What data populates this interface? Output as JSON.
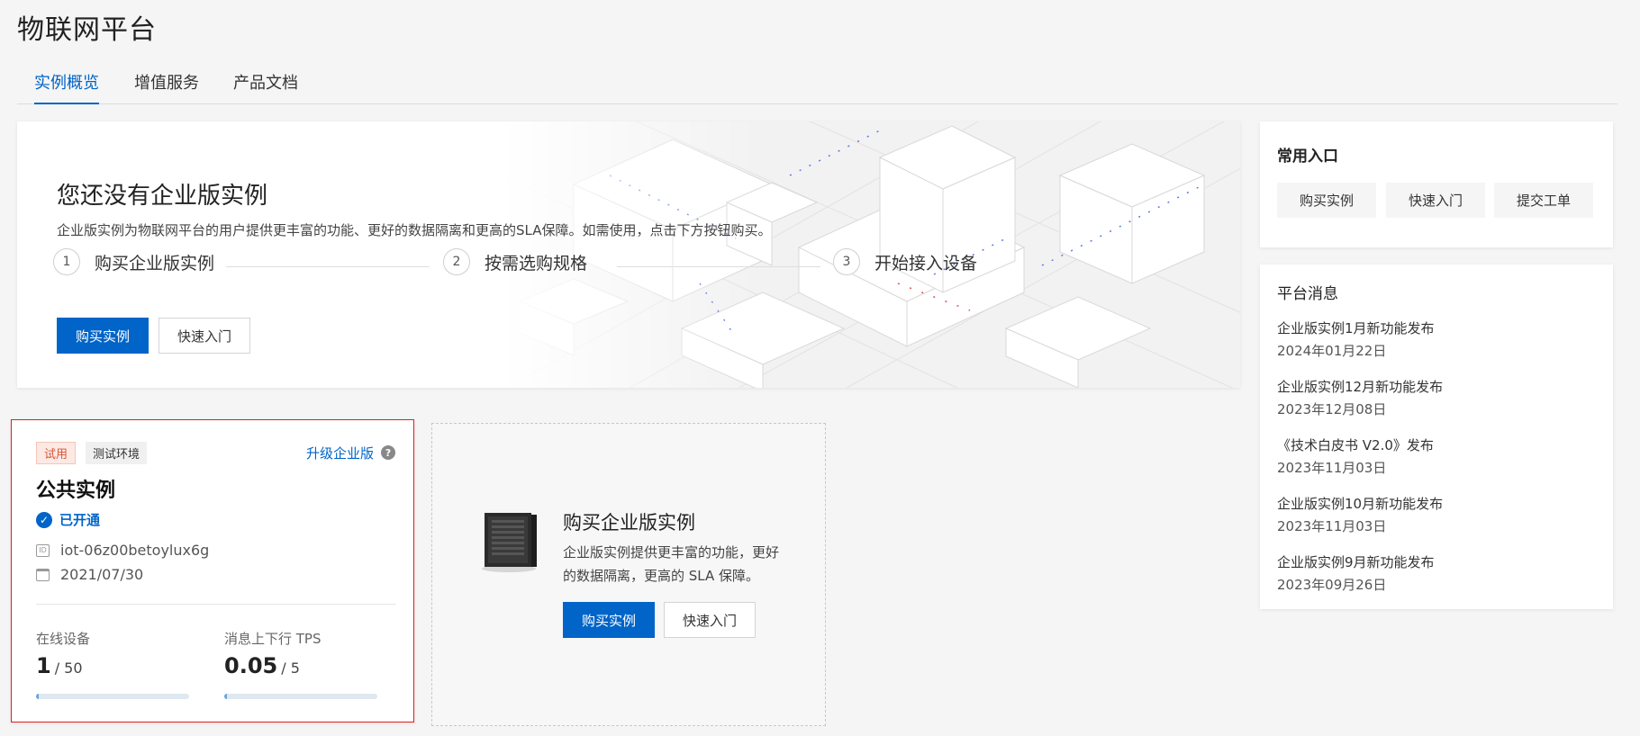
{
  "page": {
    "title": "物联网平台"
  },
  "tabs": [
    {
      "label": "实例概览",
      "active": true
    },
    {
      "label": "增值服务",
      "active": false
    },
    {
      "label": "产品文档",
      "active": false
    }
  ],
  "banner": {
    "title": "您还没有企业版实例",
    "description": "企业版实例为物联网平台的用户提供更丰富的功能、更好的数据隔离和更高的SLA保障。如需使用，点击下方按钮购买。",
    "steps": [
      {
        "num": "1",
        "label": "购买企业版实例"
      },
      {
        "num": "2",
        "label": "按需选购规格"
      },
      {
        "num": "3",
        "label": "开始接入设备"
      }
    ],
    "buy_button": "购买实例",
    "quickstart_button": "快速入门"
  },
  "common_entry": {
    "title": "常用入口",
    "buttons": [
      "购买实例",
      "快速入门",
      "提交工单"
    ]
  },
  "platform_news": {
    "title": "平台消息",
    "items": [
      {
        "title": "企业版实例1月新功能发布",
        "date": "2024年01月22日"
      },
      {
        "title": "企业版实例12月新功能发布",
        "date": "2023年12月08日"
      },
      {
        "title": "《技术白皮书 V2.0》发布",
        "date": "2023年11月03日"
      },
      {
        "title": "企业版实例10月新功能发布",
        "date": "2023年11月03日"
      },
      {
        "title": "企业版实例9月新功能发布",
        "date": "2023年09月26日"
      }
    ]
  },
  "instance": {
    "tag_trial": "试用",
    "tag_env": "测试环境",
    "upgrade_label": "升级企业版",
    "help_icon": "?",
    "title": "公共实例",
    "status": "已开通",
    "id_icon": "ID",
    "id": "iot-06z00betoylux6g",
    "date": "2021/07/30",
    "metrics": [
      {
        "label": "在线设备",
        "value": "1",
        "total": "/ 50",
        "fraction": 0.02
      },
      {
        "label": "消息上下行 TPS",
        "value": "0.05",
        "total": "/ 5",
        "fraction": 0.01
      }
    ]
  },
  "buy_card": {
    "title": "购买企业版实例",
    "description": "企业版实例提供更丰富的功能，更好的数据隔离，更高的 SLA 保障。",
    "buy_button": "购买实例",
    "quickstart_button": "快速入门"
  },
  "colors": {
    "primary": "#0064c8",
    "highlight_border": "#e02020"
  }
}
